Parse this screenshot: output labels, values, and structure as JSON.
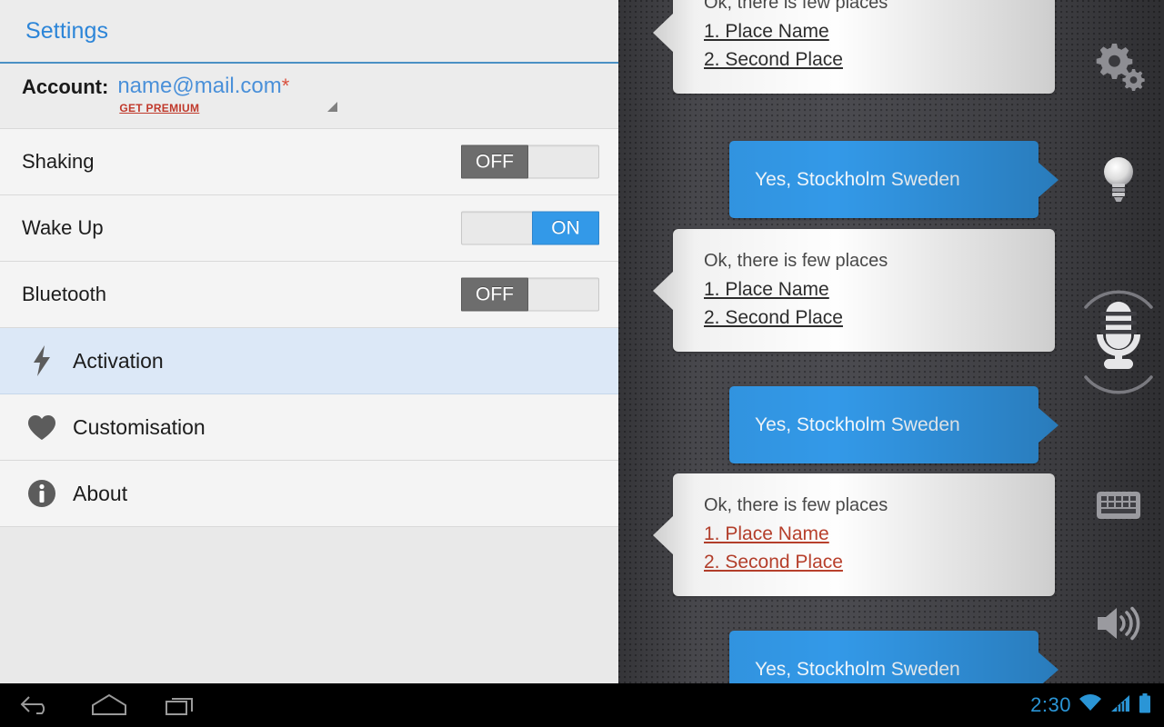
{
  "settings": {
    "title": "Settings",
    "account": {
      "label": "Account:",
      "email": "name@mail.com",
      "star": "*",
      "premium_link": "GET PREMIUM"
    },
    "toggles": [
      {
        "label": "Shaking",
        "state": "OFF",
        "on": false
      },
      {
        "label": "Wake Up",
        "state": "ON",
        "on": true
      },
      {
        "label": "Bluetooth",
        "state": "OFF",
        "on": false
      }
    ],
    "items": [
      {
        "label": "Activation",
        "icon": "lightning-bolt-icon",
        "selected": true
      },
      {
        "label": "Customisation",
        "icon": "heart-icon",
        "selected": false
      },
      {
        "label": "About",
        "icon": "info-icon",
        "selected": false
      }
    ]
  },
  "chat": {
    "messages": [
      {
        "type": "incoming",
        "text": "Ok, there is few places",
        "links": [
          "1. Place Name",
          "2. Second Place"
        ],
        "link_style": "dark"
      },
      {
        "type": "outgoing",
        "text": "Yes, Stockholm Sweden"
      },
      {
        "type": "incoming",
        "text": "Ok, there is few places",
        "links": [
          "1. Place Name",
          "2. Second Place"
        ],
        "link_style": "dark"
      },
      {
        "type": "outgoing",
        "text": "Yes, Stockholm Sweden"
      },
      {
        "type": "incoming",
        "text": "Ok, there is few places",
        "links": [
          "1. Place Name",
          "2. Second Place"
        ],
        "link_style": "red"
      },
      {
        "type": "outgoing",
        "text": "Yes, Stockholm Sweden"
      }
    ]
  },
  "rail": {
    "icons": [
      "gear-icon",
      "lightbulb-icon",
      "microphone-icon",
      "keyboard-icon",
      "speaker-icon"
    ]
  },
  "navbar": {
    "buttons": [
      "back-icon",
      "home-icon",
      "recents-icon"
    ],
    "clock": "2:30",
    "status_icons": [
      "wifi-icon",
      "cellular-signal-icon",
      "battery-icon"
    ]
  },
  "colors": {
    "accent_blue": "#3399e8",
    "title_blue": "#2c85d8",
    "premium_red": "#c0392b",
    "link_red": "#b9402c",
    "toggle_off": "#6d6d6d",
    "panel_bg": "#eaeaea",
    "chat_bg": "#4b4b50",
    "selected_row": "#dce8f7"
  }
}
